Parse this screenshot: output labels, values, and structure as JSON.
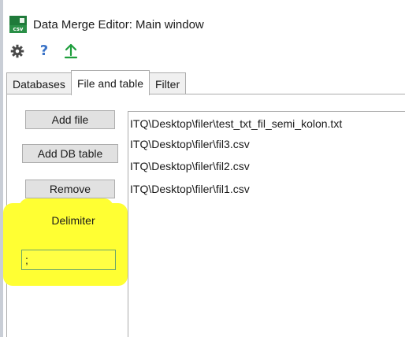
{
  "window": {
    "title": "Data Merge Editor: Main window",
    "app_icon_text": "csv"
  },
  "toolbar": {
    "icons": [
      "gear-icon",
      "help-icon",
      "upload-arrow-icon"
    ],
    "help_glyph": "?"
  },
  "tabs": [
    {
      "label": "Databases",
      "active": false
    },
    {
      "label": "File and table",
      "active": true
    },
    {
      "label": "Filter",
      "active": false
    }
  ],
  "buttons": {
    "add_file": "Add file",
    "add_db_table": "Add DB table",
    "remove": "Remove"
  },
  "delimiter": {
    "label": "Delimiter",
    "value": ";"
  },
  "files": [
    "ITQ\\Desktop\\filer\\test_txt_fil_semi_kolon.txt",
    "ITQ\\Desktop\\filer\\fil3.csv",
    "ITQ\\Desktop\\filer\\fil2.csv",
    "ITQ\\Desktop\\filer\\fil1.csv"
  ],
  "colors": {
    "highlight": "#ffff33",
    "accent_green": "#1f7a3a",
    "help_blue": "#3a73c7"
  }
}
